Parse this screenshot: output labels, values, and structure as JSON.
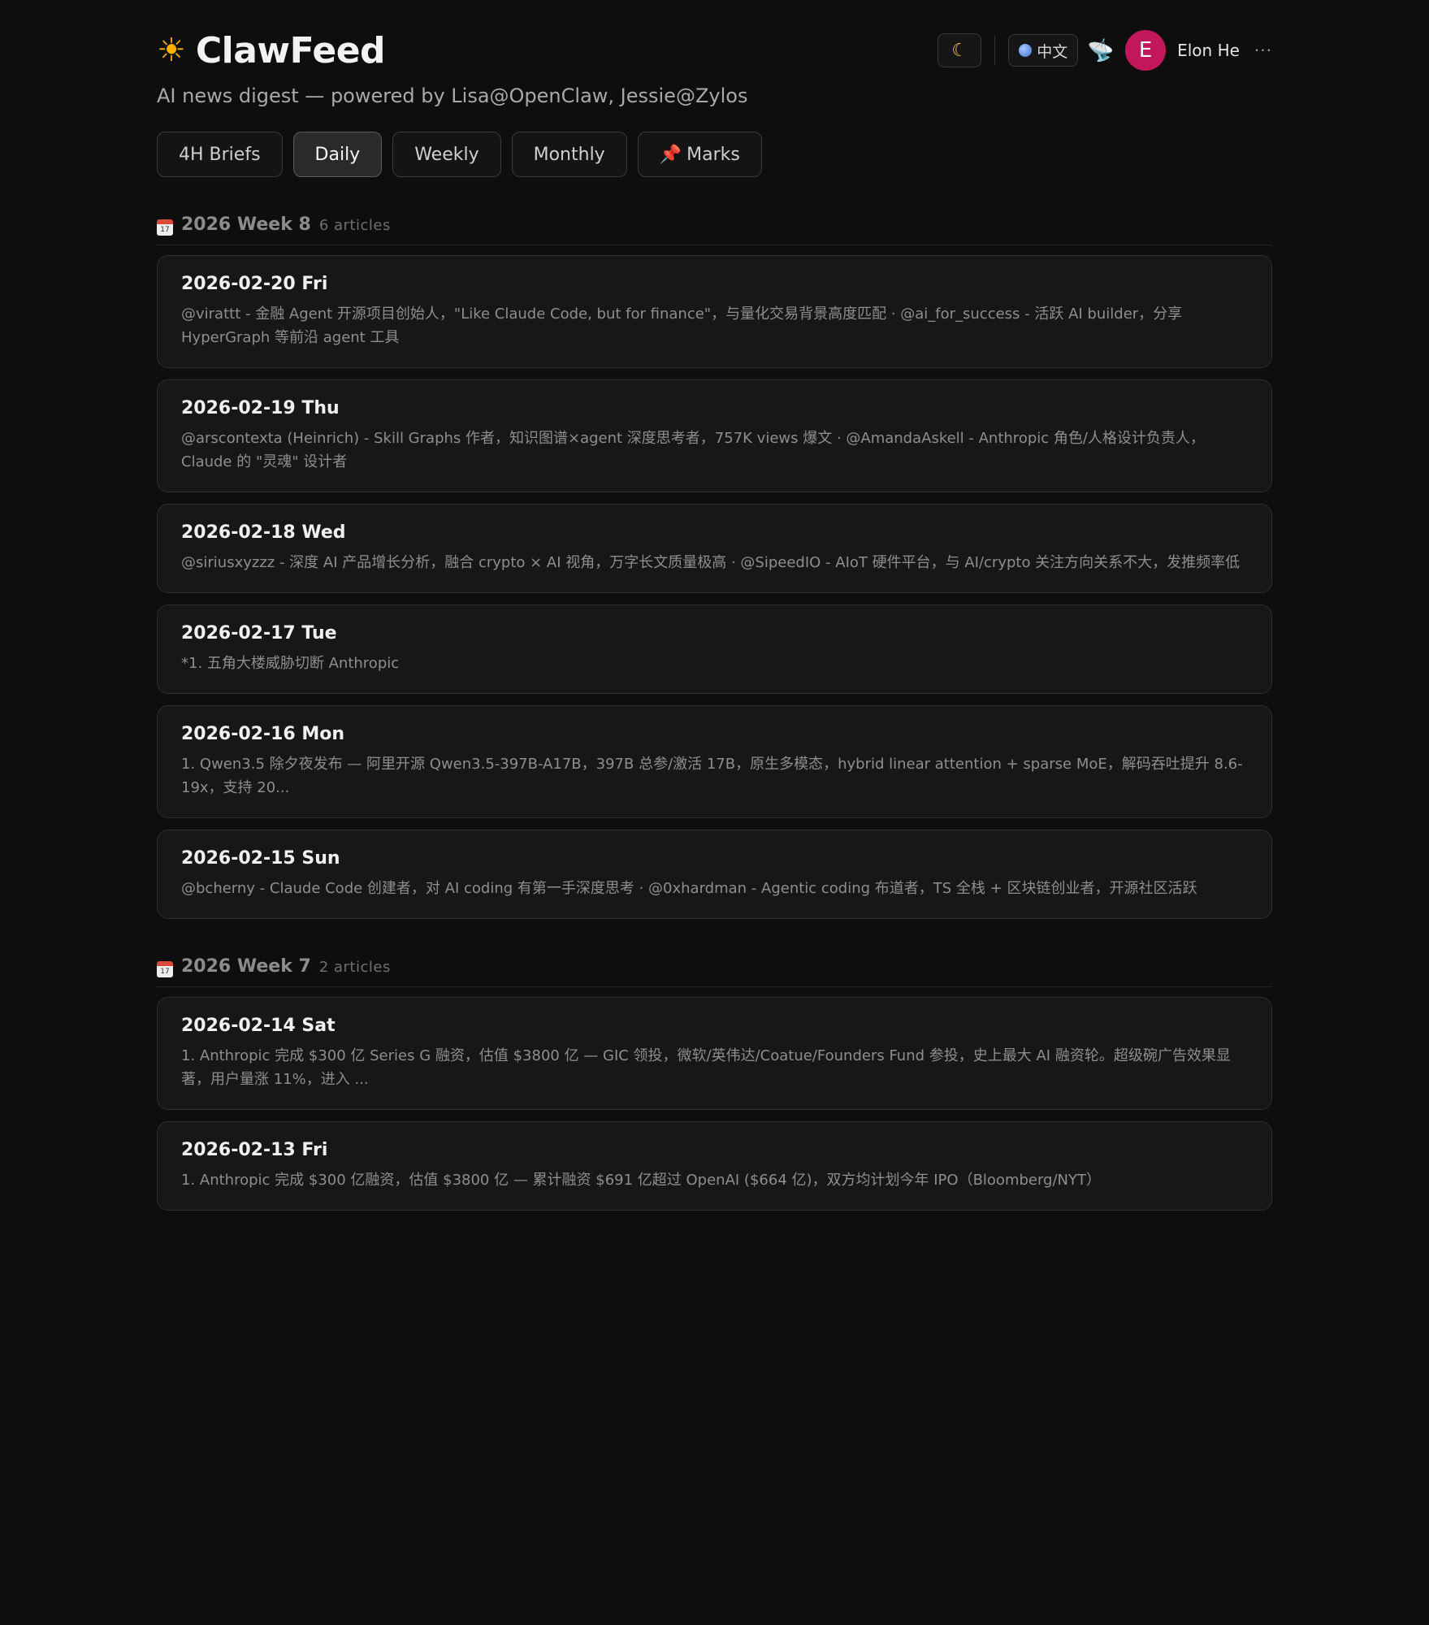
{
  "header": {
    "brand_icon": "sun-icon",
    "title": "ClawFeed",
    "subtitle": "AI news digest — powered by Lisa@OpenClaw, Jessie@Zylos",
    "theme_icon": "moon-icon",
    "lang_label": "中文",
    "rss_icon": "satellite-icon",
    "avatar_letter": "E",
    "avatar_color": "#c2185b",
    "username": "Elon He",
    "more_label": "···"
  },
  "tabs": [
    {
      "label": "4H Briefs",
      "active": false
    },
    {
      "label": "Daily",
      "active": true
    },
    {
      "label": "Weekly",
      "active": false
    },
    {
      "label": "Monthly",
      "active": false
    },
    {
      "label": "Marks",
      "active": false,
      "icon": "pin-icon"
    }
  ],
  "weeks": [
    {
      "title": "2026 Week 8",
      "count": "6 articles",
      "items": [
        {
          "date": "2026-02-20 Fri",
          "summary": "@virattt - 金融 Agent 开源项目创始人，\"Like Claude Code, but for finance\"，与量化交易背景高度匹配 · @ai_for_success - 活跃 AI builder，分享 HyperGraph 等前沿 agent 工具"
        },
        {
          "date": "2026-02-19 Thu",
          "summary": "@arscontexta (Heinrich) - Skill Graphs 作者，知识图谱×agent 深度思考者，757K views 爆文 · @AmandaAskell - Anthropic 角色/人格设计负责人，Claude 的 \"灵魂\" 设计者"
        },
        {
          "date": "2026-02-18 Wed",
          "summary": "@siriusxyzzz - 深度 AI 产品增长分析，融合 crypto × AI 视角，万字长文质量极高 · @SipeedIO - AIoT 硬件平台，与 AI/crypto 关注方向关系不大，发推频率低"
        },
        {
          "date": "2026-02-17 Tue",
          "summary": "*1. 五角大楼威胁切断 Anthropic"
        },
        {
          "date": "2026-02-16 Mon",
          "summary": "1. Qwen3.5 除夕夜发布 — 阿里开源 Qwen3.5-397B-A17B，397B 总参/激活 17B，原生多模态，hybrid linear attention + sparse MoE，解码吞吐提升 8.6-19x，支持 20..."
        },
        {
          "date": "2026-02-15 Sun",
          "summary": "@bcherny - Claude Code 创建者，对 AI coding 有第一手深度思考 · @0xhardman - Agentic coding 布道者，TS 全栈 + 区块链创业者，开源社区活跃"
        }
      ]
    },
    {
      "title": "2026 Week 7",
      "count": "2 articles",
      "items": [
        {
          "date": "2026-02-14 Sat",
          "summary": "1. Anthropic 完成 $300 亿 Series G 融资，估值 $3800 亿 — GIC 领投，微软/英伟达/Coatue/Founders Fund 参投，史上最大 AI 融资轮。超级碗广告效果显著，用户量涨 11%，进入 ..."
        },
        {
          "date": "2026-02-13 Fri",
          "summary": "1. Anthropic 完成 $300 亿融资，估值 $3800 亿 — 累计融资 $691 亿超过 OpenAI ($664 亿)，双方均计划今年 IPO（Bloomberg/NYT）"
        }
      ]
    }
  ]
}
